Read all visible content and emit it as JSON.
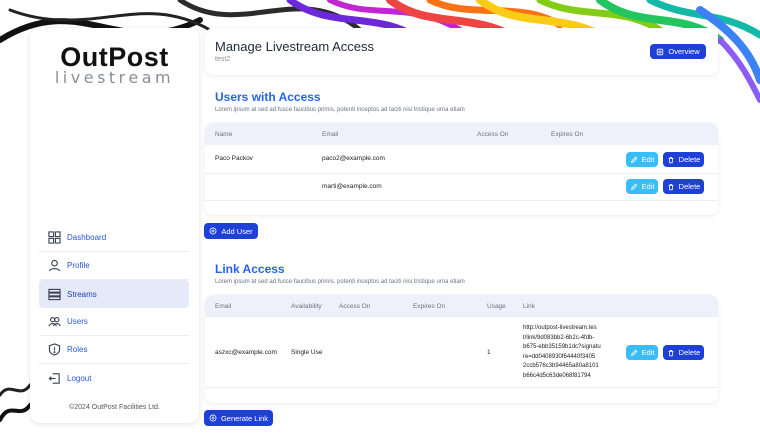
{
  "app": {
    "logo_main": "OutPost",
    "logo_sub": "livestream",
    "footer": "©2024 OutPost Facilities Ltd."
  },
  "sidebar": {
    "items": [
      {
        "label": "Dashboard",
        "icon": "grid-icon",
        "active": false
      },
      {
        "label": "Profile",
        "icon": "user-icon",
        "active": false
      },
      {
        "label": "Streams",
        "icon": "server-icon",
        "active": true
      },
      {
        "label": "Users",
        "icon": "users-icon",
        "active": false
      },
      {
        "label": "Roles",
        "icon": "shield-icon",
        "active": false
      },
      {
        "label": "Logout",
        "icon": "logout-icon",
        "active": false
      }
    ]
  },
  "header": {
    "title": "Manage Livestream Access",
    "subtitle": "test2",
    "overview_label": "Overview"
  },
  "users_section": {
    "title": "Users with Access",
    "subtitle": "Lorem ipsum at sed ad fusce faucibus primis, potenti inceptos ad taciti nisi tristique urna etiam",
    "columns": [
      "Name",
      "Email",
      "Access On",
      "Expires On"
    ],
    "rows": [
      {
        "name": "Paco Packov",
        "email": "paco2@example.com",
        "access_on": "",
        "expires_on": ""
      },
      {
        "name": "",
        "email": "marti@example.com",
        "access_on": "",
        "expires_on": ""
      }
    ],
    "edit_label": "Edit",
    "delete_label": "Delete",
    "add_label": "Add User"
  },
  "link_section": {
    "title": "Link Access",
    "subtitle": "Lorem ipsum at sed ad fusce faucibus primis, potenti inceptos ad taciti nisi tristique urna etiam",
    "columns": [
      "Email",
      "Availability",
      "Access On",
      "Expires On",
      "Usage",
      "Link"
    ],
    "rows": [
      {
        "email": "aszxc@example.com",
        "availability": "Single Use",
        "access_on": "",
        "expires_on": "",
        "usage": "1",
        "link_lines": [
          "http://outpost-livestream.tes",
          "t/link/9d083bb2-6b2c-4fdb-",
          "b675-ebb35159b1dc?signatu",
          "re=dd0408930f64440f3405",
          "2ccb576c3b94465a80a8101",
          "b66c4d5c63de068f81794"
        ]
      }
    ],
    "edit_label": "Edit",
    "delete_label": "Delete",
    "generate_label": "Generate Link"
  },
  "colors": {
    "primary": "#1e40d6",
    "edit": "#38bdf8",
    "section_title": "#2563eb",
    "active_nav": "#e6eaf8"
  }
}
